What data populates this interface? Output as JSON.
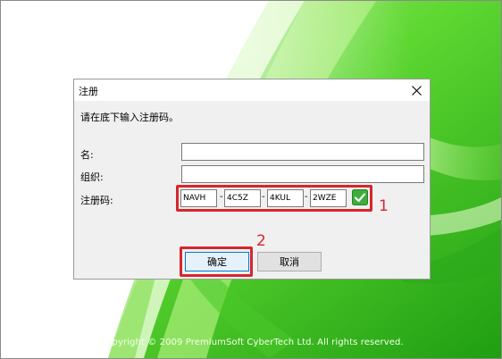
{
  "splash": {
    "copyright": "Copyright © 2009 PremiumSoft CyberTech Ltd. All rights reserved.",
    "colors": {
      "green_main": "#3fc71e",
      "green_light": "#b8f07a",
      "green_dark": "#1d9a10"
    }
  },
  "dialog": {
    "title": "注册",
    "close_icon": "close-icon",
    "prompt": "请在底下输入注册码。",
    "name_label": "名:",
    "name_value": "",
    "org_label": "组织:",
    "org_value": "",
    "code_label": "注册码:",
    "code_parts": [
      "NAVH",
      "4C5Z",
      "4KUL",
      "2WZE"
    ],
    "code_separator": "-",
    "verify_icon": "check-icon",
    "ok_label": "确定",
    "cancel_label": "取消"
  },
  "annotations": {
    "marker_1": "1",
    "marker_2": "2",
    "highlight_color": "#d7262c"
  }
}
